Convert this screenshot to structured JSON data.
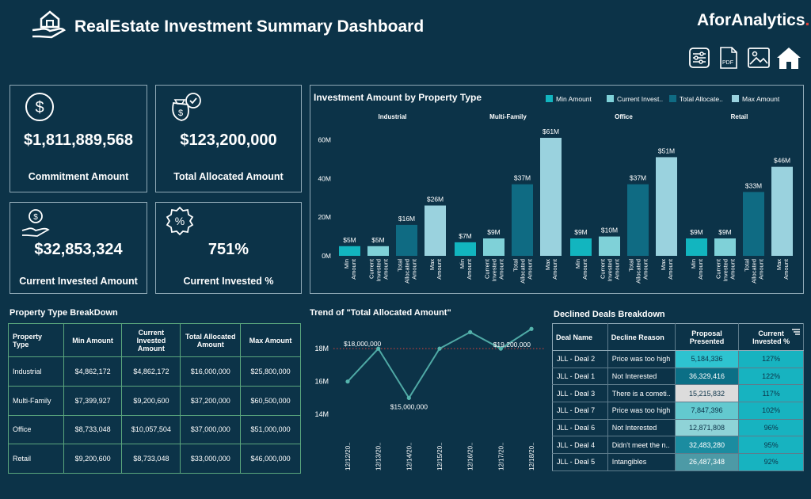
{
  "header": {
    "title": "RealEstate Investment Summary Dashboard",
    "brand": "AforAnalytics",
    "brand_dot": "."
  },
  "toolbar": {
    "icons": [
      "sliders-icon",
      "pdf-icon",
      "image-icon",
      "home-icon"
    ],
    "pdf_label": "PDF"
  },
  "kpis": {
    "commitment": {
      "value": "$1,811,889,568",
      "label": "Commitment Amount"
    },
    "allocated": {
      "value": "$123,200,000",
      "label": "Total Allocated Amount"
    },
    "invested": {
      "value": "$32,853,324",
      "label": "Current Invested Amount"
    },
    "invested_pct": {
      "value": "751%",
      "label": "Current Invested %"
    }
  },
  "bar_chart": {
    "title": "Investment Amount by Property Type",
    "legend": [
      "Min Amount",
      "Current Invest..",
      "Total Allocate..",
      "Max Amount"
    ],
    "colors": [
      "#12b5bf",
      "#7fd1d8",
      "#0f6b83",
      "#9ad2de"
    ]
  },
  "pt_table": {
    "title": "Property Type BreakDown",
    "headers": [
      "Property Type",
      "Min Amount",
      "Current Invested Amount",
      "Total Allocated Amount",
      "Max Amount"
    ],
    "rows": [
      [
        "Industrial",
        "$4,862,172",
        "$4,862,172",
        "$16,000,000",
        "$25,800,000"
      ],
      [
        "Multi-Family",
        "$7,399,927",
        "$9,200,600",
        "$37,200,000",
        "$60,500,000"
      ],
      [
        "Office",
        "$8,733,048",
        "$10,057,504",
        "$37,000,000",
        "$51,000,000"
      ],
      [
        "Retail",
        "$9,200,600",
        "$8,733,048",
        "$33,000,000",
        "$46,000,000"
      ]
    ]
  },
  "line_chart": {
    "title": "Trend of \"Total Allocated Amount\""
  },
  "dd_table": {
    "title": "Declined Deals Breakdown",
    "headers": [
      "Deal Name",
      "Decline Reason",
      "Proposal Presented",
      "Current Invested %"
    ],
    "rows": [
      {
        "name": "JLL - Deal 2",
        "reason": "Price was too high",
        "proposal": "5,184,336",
        "pct": "127%",
        "pbg": "#2ec3d0",
        "pfg": "#0c3348"
      },
      {
        "name": "JLL - Deal 1",
        "reason": "Not Interested",
        "proposal": "36,329,416",
        "pct": "122%",
        "pbg": "#0b6f86",
        "pfg": "#ffffff"
      },
      {
        "name": "JLL - Deal 3",
        "reason": "There is a cometi..",
        "proposal": "15,215,832",
        "pct": "117%",
        "pbg": "#dcdcdc",
        "pfg": "#0c3348"
      },
      {
        "name": "JLL - Deal 7",
        "reason": "Price was too high",
        "proposal": "7,847,396",
        "pct": "102%",
        "pbg": "#63c9cf",
        "pfg": "#0c3348"
      },
      {
        "name": "JLL - Deal 6",
        "reason": "Not Interested",
        "proposal": "12,871,808",
        "pct": "96%",
        "pbg": "#8fd3d7",
        "pfg": "#0c3348"
      },
      {
        "name": "JLL - Deal 4",
        "reason": "Didn't meet the n..",
        "proposal": "32,483,280",
        "pct": "95%",
        "pbg": "#1b8ca0",
        "pfg": "#ffffff"
      },
      {
        "name": "JLL - Deal 5",
        "reason": "Intangibles",
        "proposal": "26,487,348",
        "pct": "92%",
        "pbg": "#4d9aa6",
        "pfg": "#ffffff"
      }
    ],
    "pct_bg": "#17b3c0"
  },
  "chart_data": [
    {
      "type": "bar",
      "title": "Investment Amount by Property Type",
      "groups": [
        "Industrial",
        "Multi-Family",
        "Office",
        "Retail"
      ],
      "categories": [
        "Min Amount",
        "Current Invested Amount",
        "Total Allocated Amount",
        "Max Amount"
      ],
      "series": [
        {
          "name": "Industrial",
          "values": [
            5,
            5,
            16,
            26
          ],
          "labels": [
            "$5M",
            "$5M",
            "$16M",
            "$26M"
          ]
        },
        {
          "name": "Multi-Family",
          "values": [
            7,
            9,
            37,
            61
          ],
          "labels": [
            "$7M",
            "$9M",
            "$37M",
            "$61M"
          ]
        },
        {
          "name": "Office",
          "values": [
            9,
            10,
            37,
            51
          ],
          "labels": [
            "$9M",
            "$10M",
            "$37M",
            "$51M"
          ]
        },
        {
          "name": "Retail",
          "values": [
            9,
            9,
            33,
            46
          ],
          "labels": [
            "$9M",
            "$9M",
            "$33M",
            "$46M"
          ]
        }
      ],
      "yticks": [
        "0M",
        "20M",
        "40M",
        "60M"
      ],
      "ylim": [
        0,
        61
      ],
      "legend": "top-right"
    },
    {
      "type": "line",
      "title": "Trend of \"Total Allocated Amount\"",
      "x": [
        "12/12/20..",
        "12/13/20..",
        "12/14/20..",
        "12/15/20..",
        "12/16/20..",
        "12/17/20..",
        "12/18/20.."
      ],
      "values": [
        16.0,
        18.0,
        15.0,
        18.0,
        19.0,
        18.0,
        19.2
      ],
      "yticks": [
        "14M",
        "16M",
        "18M"
      ],
      "ylim": [
        13.0,
        19.5
      ],
      "annotations": [
        "$18,000,000",
        "$15,000,000",
        "$19,200,000"
      ],
      "reference_line": 18.0
    }
  ]
}
